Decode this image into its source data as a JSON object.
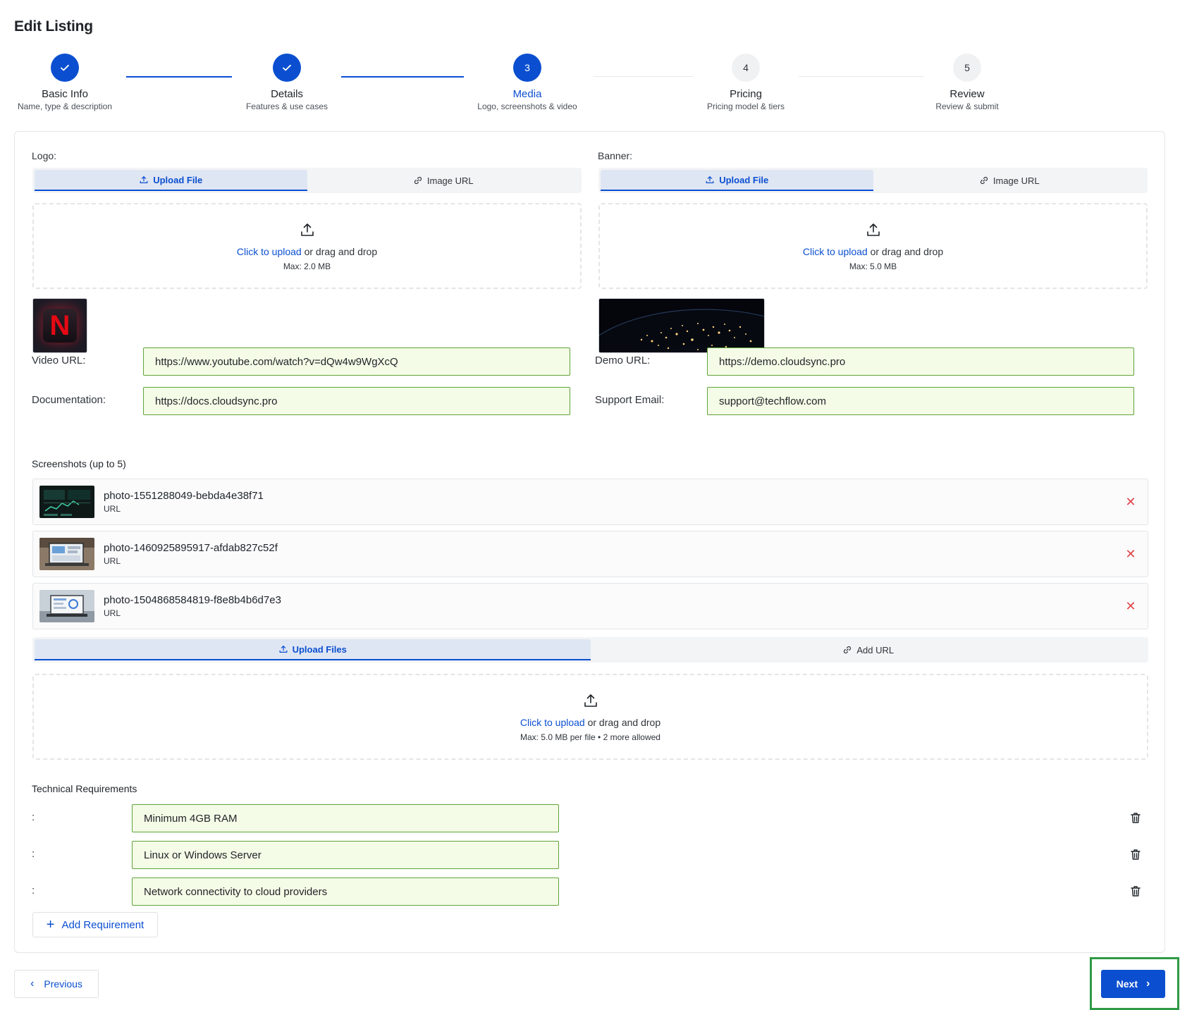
{
  "page": {
    "title": "Edit Listing"
  },
  "stepper": {
    "steps": [
      {
        "number": "1",
        "label": "Basic Info",
        "sub": "Name, type & description",
        "state": "done"
      },
      {
        "number": "2",
        "label": "Details",
        "sub": "Features & use cases",
        "state": "done"
      },
      {
        "number": "3",
        "label": "Media",
        "sub": "Logo, screenshots & video",
        "state": "active"
      },
      {
        "number": "4",
        "label": "Pricing",
        "sub": "Pricing model & tiers",
        "state": "todo"
      },
      {
        "number": "5",
        "label": "Review",
        "sub": "Review & submit",
        "state": "todo"
      }
    ]
  },
  "logo": {
    "label": "Logo:",
    "tabs": [
      {
        "label": "Upload File",
        "icon": "upload-icon"
      },
      {
        "label": "Image URL",
        "icon": "link-icon"
      }
    ],
    "dropzone": {
      "link": "Click to upload",
      "text": " or drag and drop",
      "hint": "Max: 2.0 MB"
    }
  },
  "banner": {
    "label": "Banner:",
    "tabs": [
      {
        "label": "Upload File",
        "icon": "upload-icon"
      },
      {
        "label": "Image URL",
        "icon": "link-icon"
      }
    ],
    "dropzone": {
      "link": "Click to upload",
      "text": " or drag and drop",
      "hint": "Max: 5.0 MB"
    }
  },
  "fields": {
    "video_url": {
      "label": "Video URL:",
      "value": "https://www.youtube.com/watch?v=dQw4w9WgXcQ"
    },
    "demo_url": {
      "label": "Demo URL:",
      "value": "https://demo.cloudsync.pro"
    },
    "documentation": {
      "label": "Documentation:",
      "value": "https://docs.cloudsync.pro"
    },
    "support_email": {
      "label": "Support Email:",
      "value": "support@techflow.com"
    }
  },
  "screenshots": {
    "title": "Screenshots (up to 5)",
    "items": [
      {
        "name": "photo-1551288049-bebda4e38f71",
        "type": "URL"
      },
      {
        "name": "photo-1460925895917-afdab827c52f",
        "type": "URL"
      },
      {
        "name": "photo-1504868584819-f8e8b4b6d7e3",
        "type": "URL"
      }
    ],
    "tabs": [
      {
        "label": "Upload Files",
        "icon": "upload-icon"
      },
      {
        "label": "Add URL",
        "icon": "link-icon"
      }
    ],
    "dropzone": {
      "link": "Click to upload",
      "text": " or drag and drop",
      "hint": "Max: 5.0 MB per file • 2 more allowed"
    }
  },
  "requirements": {
    "title": "Technical Requirements",
    "items": [
      {
        "label": ":",
        "value": "Minimum 4GB RAM"
      },
      {
        "label": ":",
        "value": "Linux or Windows Server"
      },
      {
        "label": ":",
        "value": "Network connectivity to cloud providers"
      }
    ],
    "add_label": "Add Requirement"
  },
  "nav": {
    "previous_label": "Previous",
    "next_label": "Next"
  },
  "colors": {
    "accent": "#0b4fd0",
    "input_bg": "#f4fbe6",
    "input_border": "#5fa33a",
    "remove": "#e0464a",
    "highlight": "#2f9a44"
  }
}
